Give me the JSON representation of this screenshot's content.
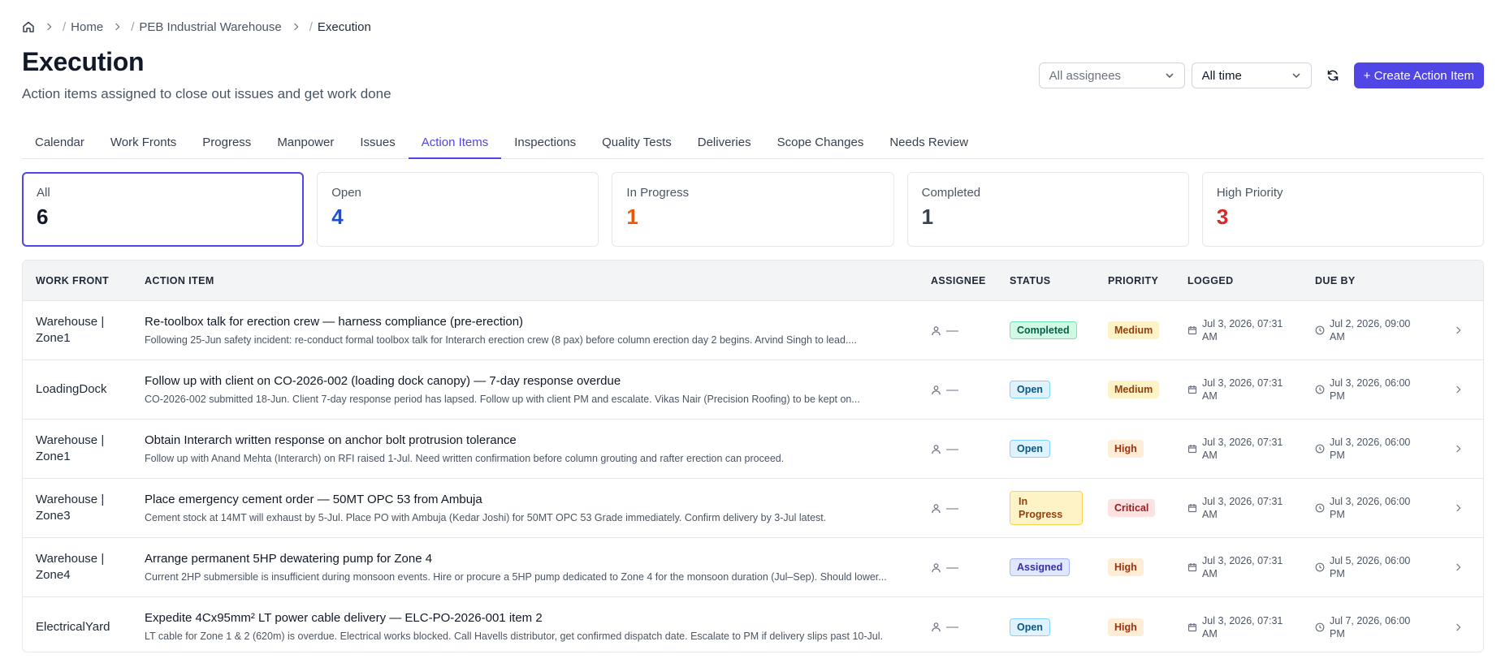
{
  "breadcrumb": {
    "items": [
      "Home",
      "PEB Industrial Warehouse",
      "Execution"
    ]
  },
  "header": {
    "title": "Execution",
    "subtitle": "Action items assigned to close out issues and get work done"
  },
  "controls": {
    "assignee_filter": "All assignees",
    "time_filter": "All time",
    "create_button": "+ Create Action Item"
  },
  "tabs": [
    {
      "label": "Calendar"
    },
    {
      "label": "Work Fronts"
    },
    {
      "label": "Progress"
    },
    {
      "label": "Manpower"
    },
    {
      "label": "Issues"
    },
    {
      "label": "Action Items",
      "active": true
    },
    {
      "label": "Inspections"
    },
    {
      "label": "Quality Tests"
    },
    {
      "label": "Deliveries"
    },
    {
      "label": "Scope Changes"
    },
    {
      "label": "Needs Review"
    }
  ],
  "stats": [
    {
      "label": "All",
      "value": "6",
      "color": "#111827",
      "active": true
    },
    {
      "label": "Open",
      "value": "4",
      "color": "#1d4ed8"
    },
    {
      "label": "In Progress",
      "value": "1",
      "color": "#ea580c"
    },
    {
      "label": "Completed",
      "value": "1",
      "color": "#374151"
    },
    {
      "label": "High Priority",
      "value": "3",
      "color": "#dc2626"
    }
  ],
  "table": {
    "headers": [
      "WORK FRONT",
      "ACTION ITEM",
      "ASSIGNEE",
      "STATUS",
      "PRIORITY",
      "LOGGED",
      "DUE BY"
    ],
    "rows": [
      {
        "work_front": "Warehouse | Zone1",
        "title": "Re-toolbox talk for erection crew — harness compliance (pre-erection)",
        "desc": "Following 25-Jun safety incident: re-conduct formal toolbox talk for Interarch erection crew (8 pax) before column erection day 2 begins. Arvind Singh to lead....",
        "assignee": "—",
        "status": "Completed",
        "priority": "Medium",
        "logged": "Jul 3, 2026, 07:31 AM",
        "due": "Jul 2, 2026, 09:00 AM"
      },
      {
        "work_front": "LoadingDock",
        "title": "Follow up with client on CO-2026-002 (loading dock canopy) — 7-day response overdue",
        "desc": "CO-2026-002 submitted 18-Jun. Client 7-day response period has lapsed. Follow up with client PM and escalate. Vikas Nair (Precision Roofing) to be kept on...",
        "assignee": "—",
        "status": "Open",
        "priority": "Medium",
        "logged": "Jul 3, 2026, 07:31 AM",
        "due": "Jul 3, 2026, 06:00 PM"
      },
      {
        "work_front": "Warehouse | Zone1",
        "title": "Obtain Interarch written response on anchor bolt protrusion tolerance",
        "desc": "Follow up with Anand Mehta (Interarch) on RFI raised 1-Jul. Need written confirmation before column grouting and rafter erection can proceed.",
        "assignee": "—",
        "status": "Open",
        "priority": "High",
        "logged": "Jul 3, 2026, 07:31 AM",
        "due": "Jul 3, 2026, 06:00 PM"
      },
      {
        "work_front": "Warehouse | Zone3",
        "title": "Place emergency cement order — 50MT OPC 53 from Ambuja",
        "desc": "Cement stock at 14MT will exhaust by 5-Jul. Place PO with Ambuja (Kedar Joshi) for 50MT OPC 53 Grade immediately. Confirm delivery by 3-Jul latest.",
        "assignee": "—",
        "status": "In Progress",
        "priority": "Critical",
        "logged": "Jul 3, 2026, 07:31 AM",
        "due": "Jul 3, 2026, 06:00 PM"
      },
      {
        "work_front": "Warehouse | Zone4",
        "title": "Arrange permanent 5HP dewatering pump for Zone 4",
        "desc": "Current 2HP submersible is insufficient during monsoon events. Hire or procure a 5HP pump dedicated to Zone 4 for the monsoon duration (Jul–Sep). Should lower...",
        "assignee": "—",
        "status": "Assigned",
        "priority": "High",
        "logged": "Jul 3, 2026, 07:31 AM",
        "due": "Jul 5, 2026, 06:00 PM"
      },
      {
        "work_front": "ElectricalYard",
        "title": "Expedite 4Cx95mm² LT power cable delivery — ELC-PO-2026-001 item 2",
        "desc": "LT cable for Zone 1 & 2 (620m) is overdue. Electrical works blocked. Call Havells distributor, get confirmed dispatch date. Escalate to PM if delivery slips past 10-Jul.",
        "assignee": "—",
        "status": "Open",
        "priority": "High",
        "logged": "Jul 3, 2026, 07:31 AM",
        "due": "Jul 7, 2026, 06:00 PM"
      }
    ]
  },
  "colors": {
    "accent": "#4f46e5",
    "status": {
      "Completed": {
        "bg": "#d1fae5",
        "border": "#6ee7b7",
        "fg": "#065f46"
      },
      "Open": {
        "bg": "#e0f2fe",
        "border": "#7dd3fc",
        "fg": "#075985"
      },
      "In Progress": {
        "bg": "#fef3c7",
        "border": "#fcd34d",
        "fg": "#92400e"
      },
      "Assigned": {
        "bg": "#e0e7ff",
        "border": "#a5b4fc",
        "fg": "#3730a3"
      }
    },
    "priority": {
      "Medium": {
        "bg": "#fef3c7",
        "fg": "#92400e"
      },
      "High": {
        "bg": "#ffedd5",
        "fg": "#9a3412"
      },
      "Critical": {
        "bg": "#fee2e2",
        "fg": "#991b1b"
      }
    }
  }
}
